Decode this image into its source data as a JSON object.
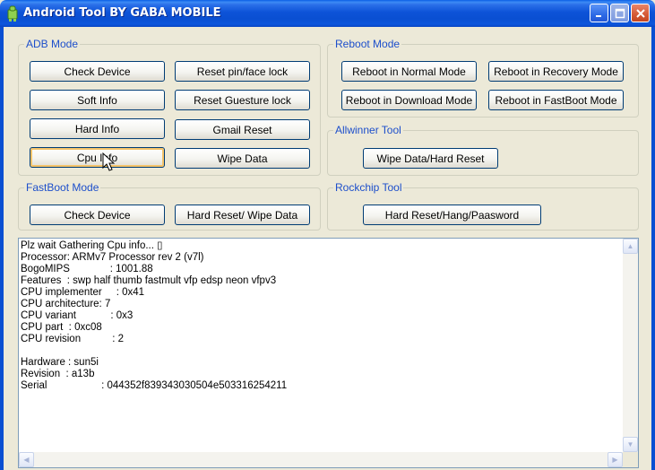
{
  "window": {
    "title": "Android Tool BY GABA MOBILE"
  },
  "groups": {
    "adb": {
      "title": "ADB Mode",
      "check_device": "Check Device",
      "reset_pin": "Reset pin/face lock",
      "soft_info": "Soft Info",
      "reset_gesture": "Reset Guesture lock",
      "hard_info": "Hard Info",
      "gmail_reset": "Gmail Reset",
      "cpu_info": "Cpu Info",
      "wipe_data": "Wipe Data"
    },
    "reboot": {
      "title": "Reboot Mode",
      "normal": "Reboot in Normal Mode",
      "recovery": "Reboot in Recovery Mode",
      "download": "Reboot in Download Mode",
      "fastboot": "Reboot in FastBoot Mode"
    },
    "allwinner": {
      "title": "Allwinner Tool",
      "wipe_hard_reset": "Wipe Data/Hard Reset"
    },
    "fastboot": {
      "title": "FastBoot Mode",
      "check_device": "Check Device",
      "hard_reset_wipe": "Hard Reset/ Wipe Data"
    },
    "rockchip": {
      "title": "Rockchip Tool",
      "hard_reset_hang": "Hard Reset/Hang/Paasword"
    }
  },
  "console": {
    "output": "Plz wait Gathering Cpu info... ▯\nProcessor: ARMv7 Processor rev 2 (v7l)\nBogoMIPS              : 1001.88\nFeatures  : swp half thumb fastmult vfp edsp neon vfpv3\nCPU implementer     : 0x41\nCPU architecture: 7\nCPU variant            : 0x3\nCPU part  : 0xc08\nCPU revision           : 2\n\nHardware : sun5i\nRevision  : a13b\nSerial                   : 044352f839343030504e503316254211"
  },
  "scrollbar": {
    "up": "▲",
    "down": "▼",
    "left": "◀",
    "right": "▶"
  }
}
